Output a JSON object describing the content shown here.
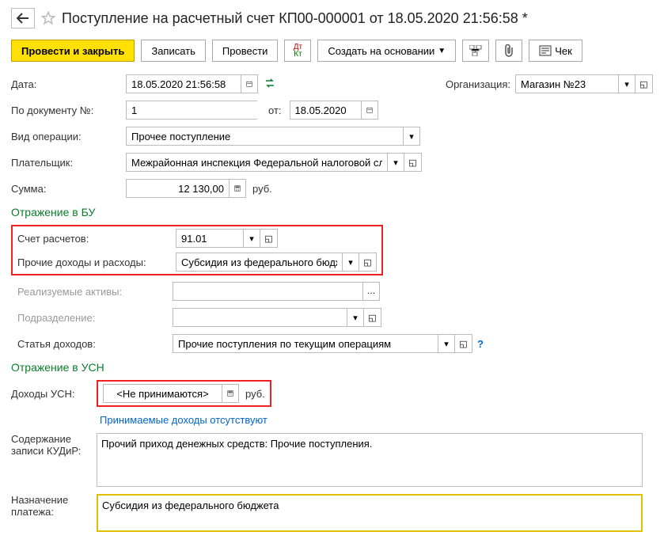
{
  "header": {
    "title": "Поступление на расчетный счет КП00-000001 от 18.05.2020 21:56:58 *"
  },
  "toolbar": {
    "post_close": "Провести и закрыть",
    "save": "Записать",
    "post": "Провести",
    "create_based": "Создать на основании",
    "check": "Чек"
  },
  "form": {
    "date_label": "Дата:",
    "date_value": "18.05.2020 21:56:58",
    "org_label": "Организация:",
    "org_value": "Магазин №23",
    "docnum_label": "По документу №:",
    "docnum_value": "1",
    "from_label": "от:",
    "from_value": "18.05.2020",
    "op_label": "Вид операции:",
    "op_value": "Прочее поступление",
    "payer_label": "Плательщик:",
    "payer_value": "Межрайонная инспекция Федеральной налоговой службы",
    "sum_label": "Сумма:",
    "sum_value": "12 130,00",
    "currency": "руб."
  },
  "bu": {
    "section": "Отражение в БУ",
    "acc_label": "Счет расчетов:",
    "acc_value": "91.01",
    "other_label": "Прочие доходы и расходы:",
    "other_value": "Субсидия из федерального бюджета",
    "assets_label": "Реализуемые активы:",
    "assets_value": "",
    "subdiv_label": "Подразделение:",
    "subdiv_value": "",
    "income_label": "Статья доходов:",
    "income_value": "Прочие поступления по текущим операциям"
  },
  "usn": {
    "section": "Отражение в УСН",
    "usn_label": "Доходы УСН:",
    "usn_value": "<Не принимаются>",
    "currency": "руб.",
    "note_link": "Принимаемые доходы отсутствуют",
    "kudir_label": "Содержание записи КУДиР:",
    "kudir_value": "Прочий приход денежных средств: Прочие поступления.",
    "purpose_label": "Назначение платежа:",
    "purpose_value": "Субсидия из федерального бюджета"
  }
}
